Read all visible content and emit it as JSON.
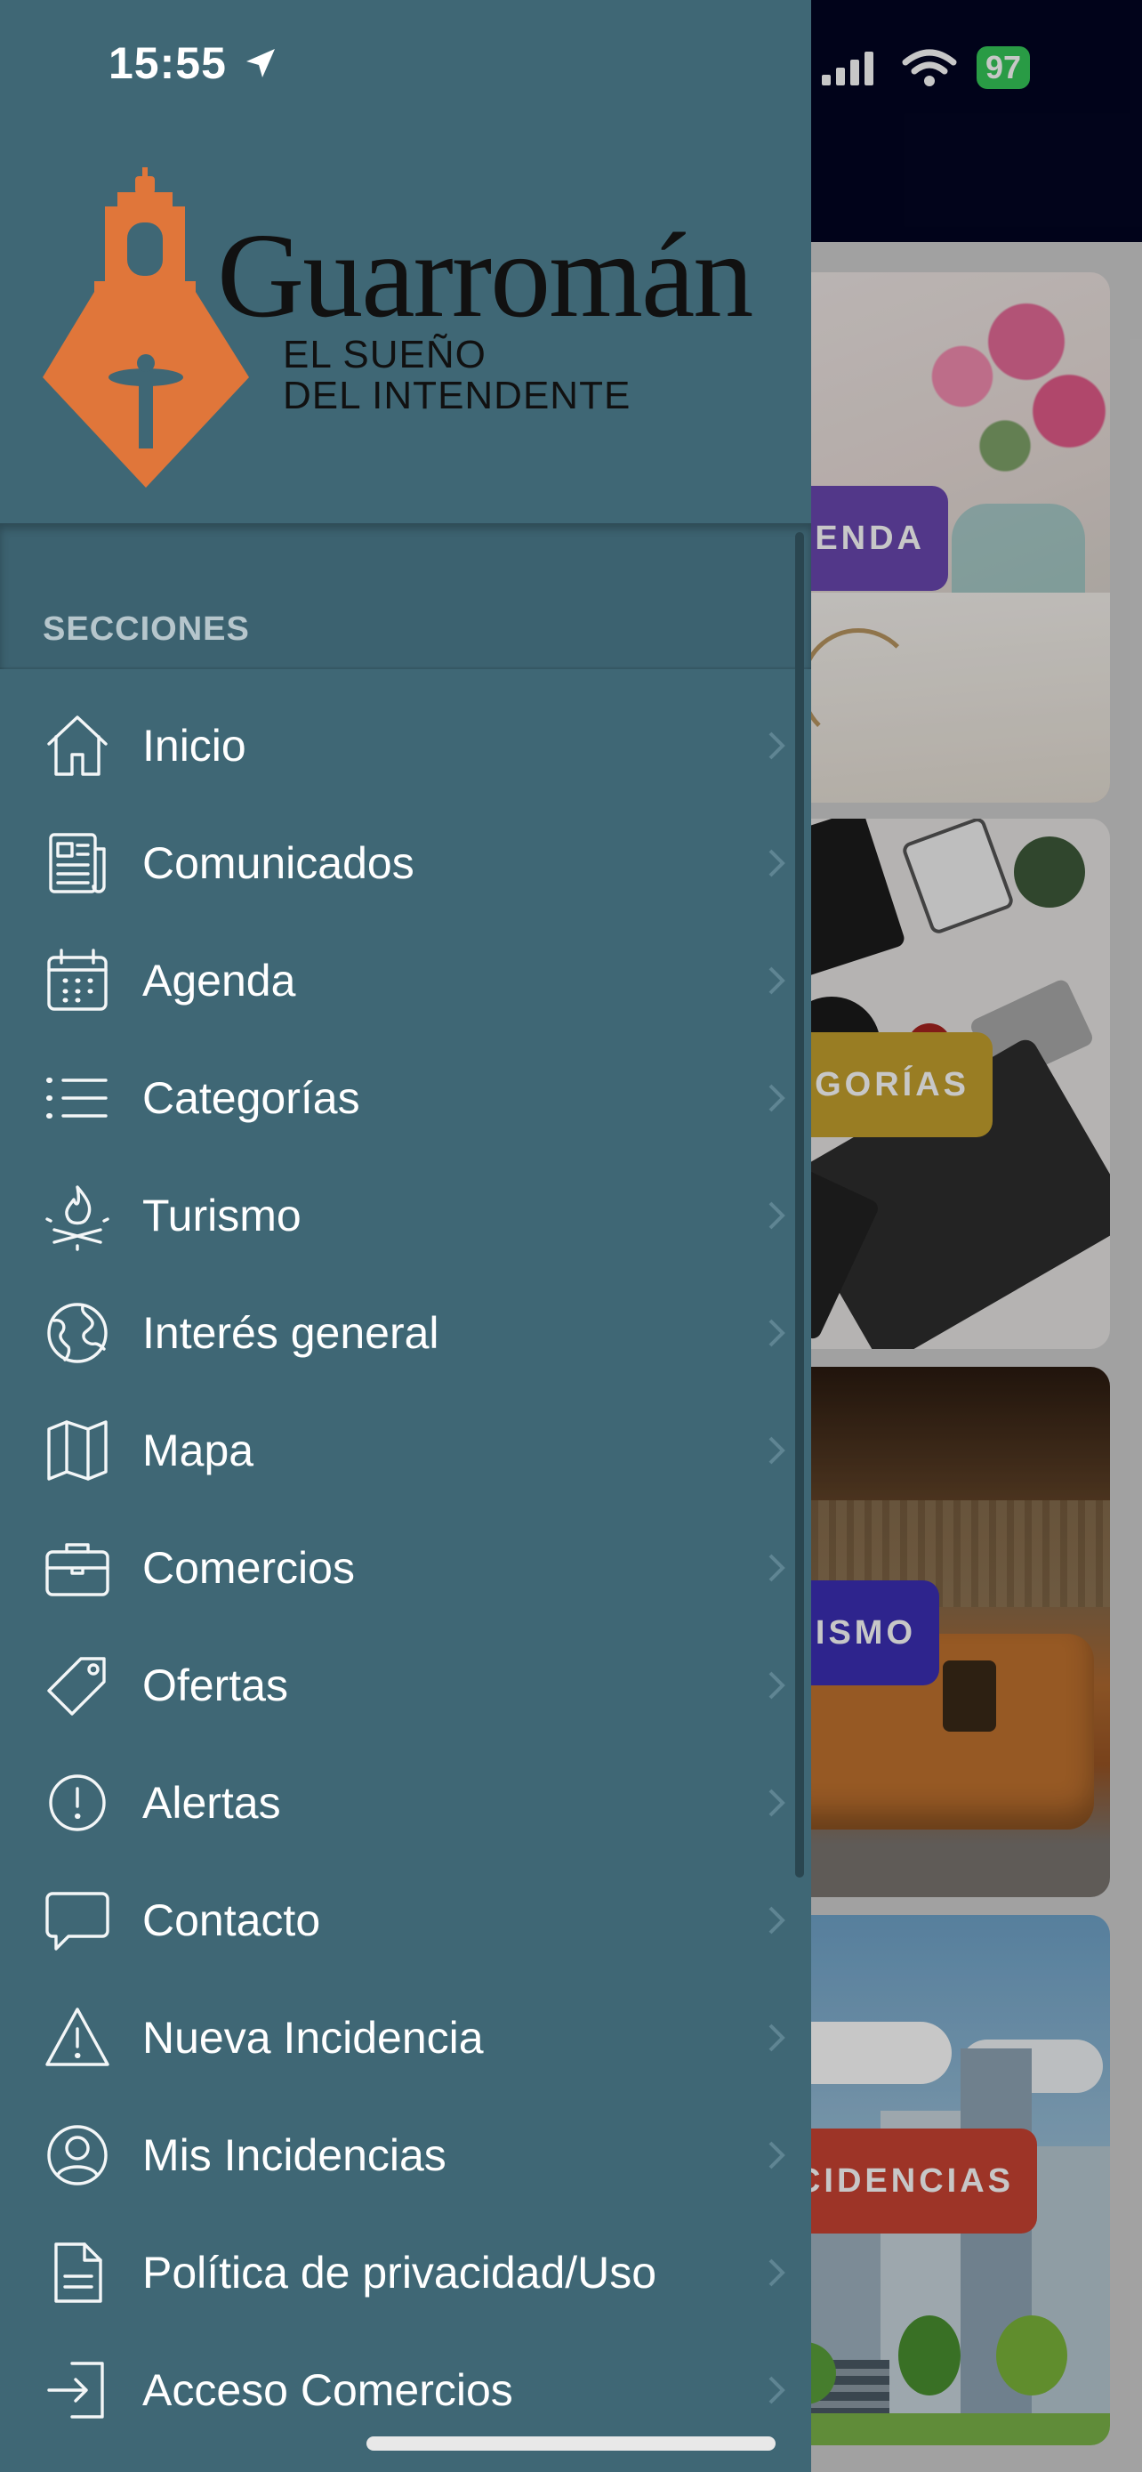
{
  "status_bar": {
    "time": "15:55",
    "battery": "97"
  },
  "logo": {
    "name": "Guarromán",
    "tagline_line1": "EL SUEÑO",
    "tagline_line2": "DEL INTENDENTE"
  },
  "drawer": {
    "section_title": "SECCIONES",
    "items": [
      {
        "label": "Inicio",
        "icon": "home-icon"
      },
      {
        "label": "Comunicados",
        "icon": "newspaper-icon"
      },
      {
        "label": "Agenda",
        "icon": "calendar-icon"
      },
      {
        "label": "Categorías",
        "icon": "list-icon"
      },
      {
        "label": "Turismo",
        "icon": "campfire-icon"
      },
      {
        "label": "Interés general",
        "icon": "globe-icon"
      },
      {
        "label": "Mapa",
        "icon": "map-icon"
      },
      {
        "label": "Comercios",
        "icon": "briefcase-icon"
      },
      {
        "label": "Ofertas",
        "icon": "price-tag-icon"
      },
      {
        "label": "Alertas",
        "icon": "alert-circle-icon"
      },
      {
        "label": "Contacto",
        "icon": "chat-bubble-icon"
      },
      {
        "label": "Nueva Incidencia",
        "icon": "warning-triangle-icon"
      },
      {
        "label": "Mis Incidencias",
        "icon": "user-circle-icon"
      },
      {
        "label": "Política de privacidad/Uso",
        "icon": "document-icon"
      },
      {
        "label": "Acceso Comercios",
        "icon": "login-icon"
      }
    ]
  },
  "background_cards": [
    {
      "label": "ENDA",
      "color": "#6a47b0"
    },
    {
      "label": "EGORÍAS",
      "color": "#c5a02e"
    },
    {
      "label": "RISMO",
      "color": "#3b2fb5"
    },
    {
      "label": "CIDENCIAS",
      "color": "#c94333"
    }
  ],
  "colors": {
    "drawer_bg": "#3f6775",
    "appbar_bg": "#020522",
    "logo_orange": "#e0763a"
  }
}
